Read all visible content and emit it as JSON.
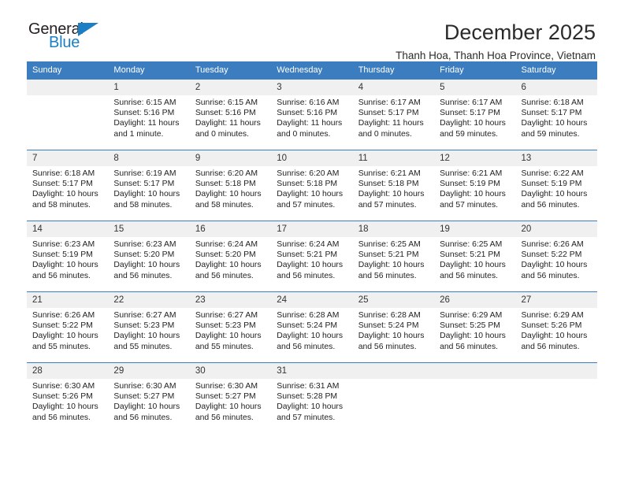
{
  "brand": {
    "name_top": "General",
    "name_bottom": "Blue",
    "triangle_color": "#1b7fc4"
  },
  "header": {
    "month_title": "December 2025",
    "location": "Thanh Hoa, Thanh Hoa Province, Vietnam"
  },
  "theme": {
    "header_row_bg": "#3b7dbf",
    "daynum_bg": "#f0f0f0",
    "grid_line": "#3b7dbf"
  },
  "weekdays": [
    "Sunday",
    "Monday",
    "Tuesday",
    "Wednesday",
    "Thursday",
    "Friday",
    "Saturday"
  ],
  "weeks": [
    [
      {
        "day": "",
        "empty": true
      },
      {
        "day": "1",
        "sunrise": "Sunrise: 6:15 AM",
        "sunset": "Sunset: 5:16 PM",
        "daylight1": "Daylight: 11 hours",
        "daylight2": "and 1 minute."
      },
      {
        "day": "2",
        "sunrise": "Sunrise: 6:15 AM",
        "sunset": "Sunset: 5:16 PM",
        "daylight1": "Daylight: 11 hours",
        "daylight2": "and 0 minutes."
      },
      {
        "day": "3",
        "sunrise": "Sunrise: 6:16 AM",
        "sunset": "Sunset: 5:16 PM",
        "daylight1": "Daylight: 11 hours",
        "daylight2": "and 0 minutes."
      },
      {
        "day": "4",
        "sunrise": "Sunrise: 6:17 AM",
        "sunset": "Sunset: 5:17 PM",
        "daylight1": "Daylight: 11 hours",
        "daylight2": "and 0 minutes."
      },
      {
        "day": "5",
        "sunrise": "Sunrise: 6:17 AM",
        "sunset": "Sunset: 5:17 PM",
        "daylight1": "Daylight: 10 hours",
        "daylight2": "and 59 minutes."
      },
      {
        "day": "6",
        "sunrise": "Sunrise: 6:18 AM",
        "sunset": "Sunset: 5:17 PM",
        "daylight1": "Daylight: 10 hours",
        "daylight2": "and 59 minutes."
      }
    ],
    [
      {
        "day": "7",
        "sunrise": "Sunrise: 6:18 AM",
        "sunset": "Sunset: 5:17 PM",
        "daylight1": "Daylight: 10 hours",
        "daylight2": "and 58 minutes."
      },
      {
        "day": "8",
        "sunrise": "Sunrise: 6:19 AM",
        "sunset": "Sunset: 5:17 PM",
        "daylight1": "Daylight: 10 hours",
        "daylight2": "and 58 minutes."
      },
      {
        "day": "9",
        "sunrise": "Sunrise: 6:20 AM",
        "sunset": "Sunset: 5:18 PM",
        "daylight1": "Daylight: 10 hours",
        "daylight2": "and 58 minutes."
      },
      {
        "day": "10",
        "sunrise": "Sunrise: 6:20 AM",
        "sunset": "Sunset: 5:18 PM",
        "daylight1": "Daylight: 10 hours",
        "daylight2": "and 57 minutes."
      },
      {
        "day": "11",
        "sunrise": "Sunrise: 6:21 AM",
        "sunset": "Sunset: 5:18 PM",
        "daylight1": "Daylight: 10 hours",
        "daylight2": "and 57 minutes."
      },
      {
        "day": "12",
        "sunrise": "Sunrise: 6:21 AM",
        "sunset": "Sunset: 5:19 PM",
        "daylight1": "Daylight: 10 hours",
        "daylight2": "and 57 minutes."
      },
      {
        "day": "13",
        "sunrise": "Sunrise: 6:22 AM",
        "sunset": "Sunset: 5:19 PM",
        "daylight1": "Daylight: 10 hours",
        "daylight2": "and 56 minutes."
      }
    ],
    [
      {
        "day": "14",
        "sunrise": "Sunrise: 6:23 AM",
        "sunset": "Sunset: 5:19 PM",
        "daylight1": "Daylight: 10 hours",
        "daylight2": "and 56 minutes."
      },
      {
        "day": "15",
        "sunrise": "Sunrise: 6:23 AM",
        "sunset": "Sunset: 5:20 PM",
        "daylight1": "Daylight: 10 hours",
        "daylight2": "and 56 minutes."
      },
      {
        "day": "16",
        "sunrise": "Sunrise: 6:24 AM",
        "sunset": "Sunset: 5:20 PM",
        "daylight1": "Daylight: 10 hours",
        "daylight2": "and 56 minutes."
      },
      {
        "day": "17",
        "sunrise": "Sunrise: 6:24 AM",
        "sunset": "Sunset: 5:21 PM",
        "daylight1": "Daylight: 10 hours",
        "daylight2": "and 56 minutes."
      },
      {
        "day": "18",
        "sunrise": "Sunrise: 6:25 AM",
        "sunset": "Sunset: 5:21 PM",
        "daylight1": "Daylight: 10 hours",
        "daylight2": "and 56 minutes."
      },
      {
        "day": "19",
        "sunrise": "Sunrise: 6:25 AM",
        "sunset": "Sunset: 5:21 PM",
        "daylight1": "Daylight: 10 hours",
        "daylight2": "and 56 minutes."
      },
      {
        "day": "20",
        "sunrise": "Sunrise: 6:26 AM",
        "sunset": "Sunset: 5:22 PM",
        "daylight1": "Daylight: 10 hours",
        "daylight2": "and 56 minutes."
      }
    ],
    [
      {
        "day": "21",
        "sunrise": "Sunrise: 6:26 AM",
        "sunset": "Sunset: 5:22 PM",
        "daylight1": "Daylight: 10 hours",
        "daylight2": "and 55 minutes."
      },
      {
        "day": "22",
        "sunrise": "Sunrise: 6:27 AM",
        "sunset": "Sunset: 5:23 PM",
        "daylight1": "Daylight: 10 hours",
        "daylight2": "and 55 minutes."
      },
      {
        "day": "23",
        "sunrise": "Sunrise: 6:27 AM",
        "sunset": "Sunset: 5:23 PM",
        "daylight1": "Daylight: 10 hours",
        "daylight2": "and 55 minutes."
      },
      {
        "day": "24",
        "sunrise": "Sunrise: 6:28 AM",
        "sunset": "Sunset: 5:24 PM",
        "daylight1": "Daylight: 10 hours",
        "daylight2": "and 56 minutes."
      },
      {
        "day": "25",
        "sunrise": "Sunrise: 6:28 AM",
        "sunset": "Sunset: 5:24 PM",
        "daylight1": "Daylight: 10 hours",
        "daylight2": "and 56 minutes."
      },
      {
        "day": "26",
        "sunrise": "Sunrise: 6:29 AM",
        "sunset": "Sunset: 5:25 PM",
        "daylight1": "Daylight: 10 hours",
        "daylight2": "and 56 minutes."
      },
      {
        "day": "27",
        "sunrise": "Sunrise: 6:29 AM",
        "sunset": "Sunset: 5:26 PM",
        "daylight1": "Daylight: 10 hours",
        "daylight2": "and 56 minutes."
      }
    ],
    [
      {
        "day": "28",
        "sunrise": "Sunrise: 6:30 AM",
        "sunset": "Sunset: 5:26 PM",
        "daylight1": "Daylight: 10 hours",
        "daylight2": "and 56 minutes."
      },
      {
        "day": "29",
        "sunrise": "Sunrise: 6:30 AM",
        "sunset": "Sunset: 5:27 PM",
        "daylight1": "Daylight: 10 hours",
        "daylight2": "and 56 minutes."
      },
      {
        "day": "30",
        "sunrise": "Sunrise: 6:30 AM",
        "sunset": "Sunset: 5:27 PM",
        "daylight1": "Daylight: 10 hours",
        "daylight2": "and 56 minutes."
      },
      {
        "day": "31",
        "sunrise": "Sunrise: 6:31 AM",
        "sunset": "Sunset: 5:28 PM",
        "daylight1": "Daylight: 10 hours",
        "daylight2": "and 57 minutes."
      },
      {
        "day": "",
        "empty": true
      },
      {
        "day": "",
        "empty": true
      },
      {
        "day": "",
        "empty": true
      }
    ]
  ]
}
